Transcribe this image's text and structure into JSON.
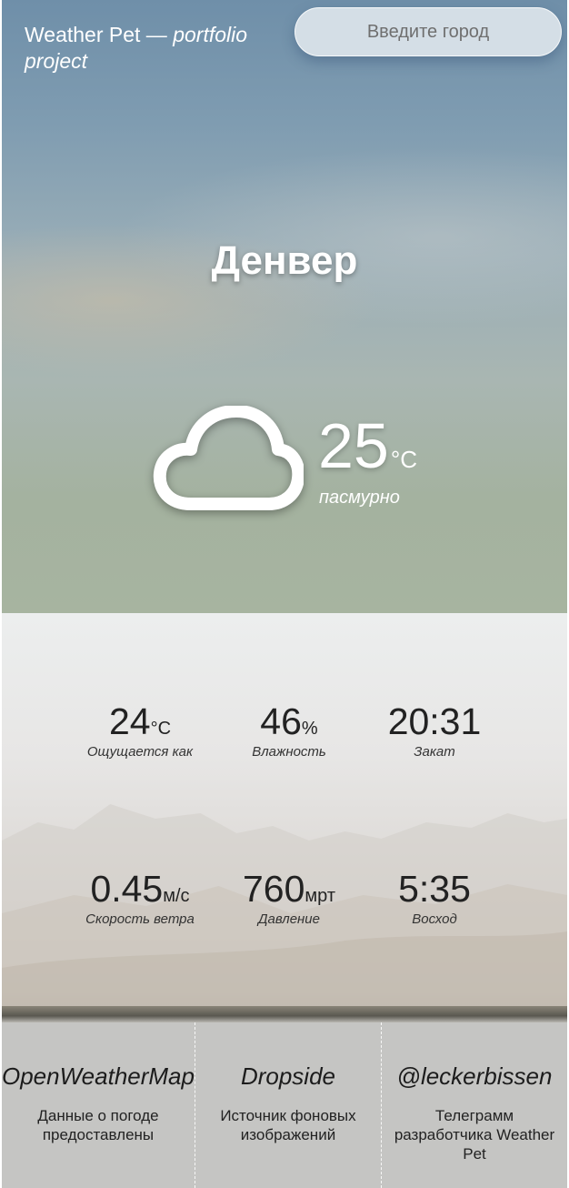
{
  "header": {
    "brand_name": "Weather Pet",
    "brand_dash": " — ",
    "brand_italic": "portfolio project",
    "search_placeholder": "Введите город"
  },
  "current": {
    "city": "Денвер",
    "icon": "cloud-icon",
    "temperature": "25",
    "temperature_unit": "°C",
    "condition": "пасмурно"
  },
  "stats": [
    {
      "value": "24",
      "unit": "°C",
      "label": "Ощущается как"
    },
    {
      "value": "46",
      "unit": "%",
      "label": "Влажность"
    },
    {
      "value": "20:31",
      "unit": "",
      "label": "Закат"
    },
    {
      "value": "0.45",
      "unit": "м/с",
      "label": "Скорость ветра"
    },
    {
      "value": "760",
      "unit": "мрт",
      "label": "Давление"
    },
    {
      "value": "5:35",
      "unit": "",
      "label": "Восход"
    }
  ],
  "footer": [
    {
      "title": "OpenWeatherMap",
      "description": "Данные о погоде предоставлены"
    },
    {
      "title": "Dropside",
      "description": "Источник фоновых изображений"
    },
    {
      "title": "@leckerbissen",
      "description": "Телеграмм разработчика Weather Pet"
    }
  ],
  "colors": {
    "sky_top": "#6f8fa9",
    "sky_bottom": "#a7b4a0",
    "details_bg": "#e7e6e5",
    "footer_bg": "#c5c5c3",
    "text_dark": "#222222",
    "text_light": "#ffffff"
  }
}
